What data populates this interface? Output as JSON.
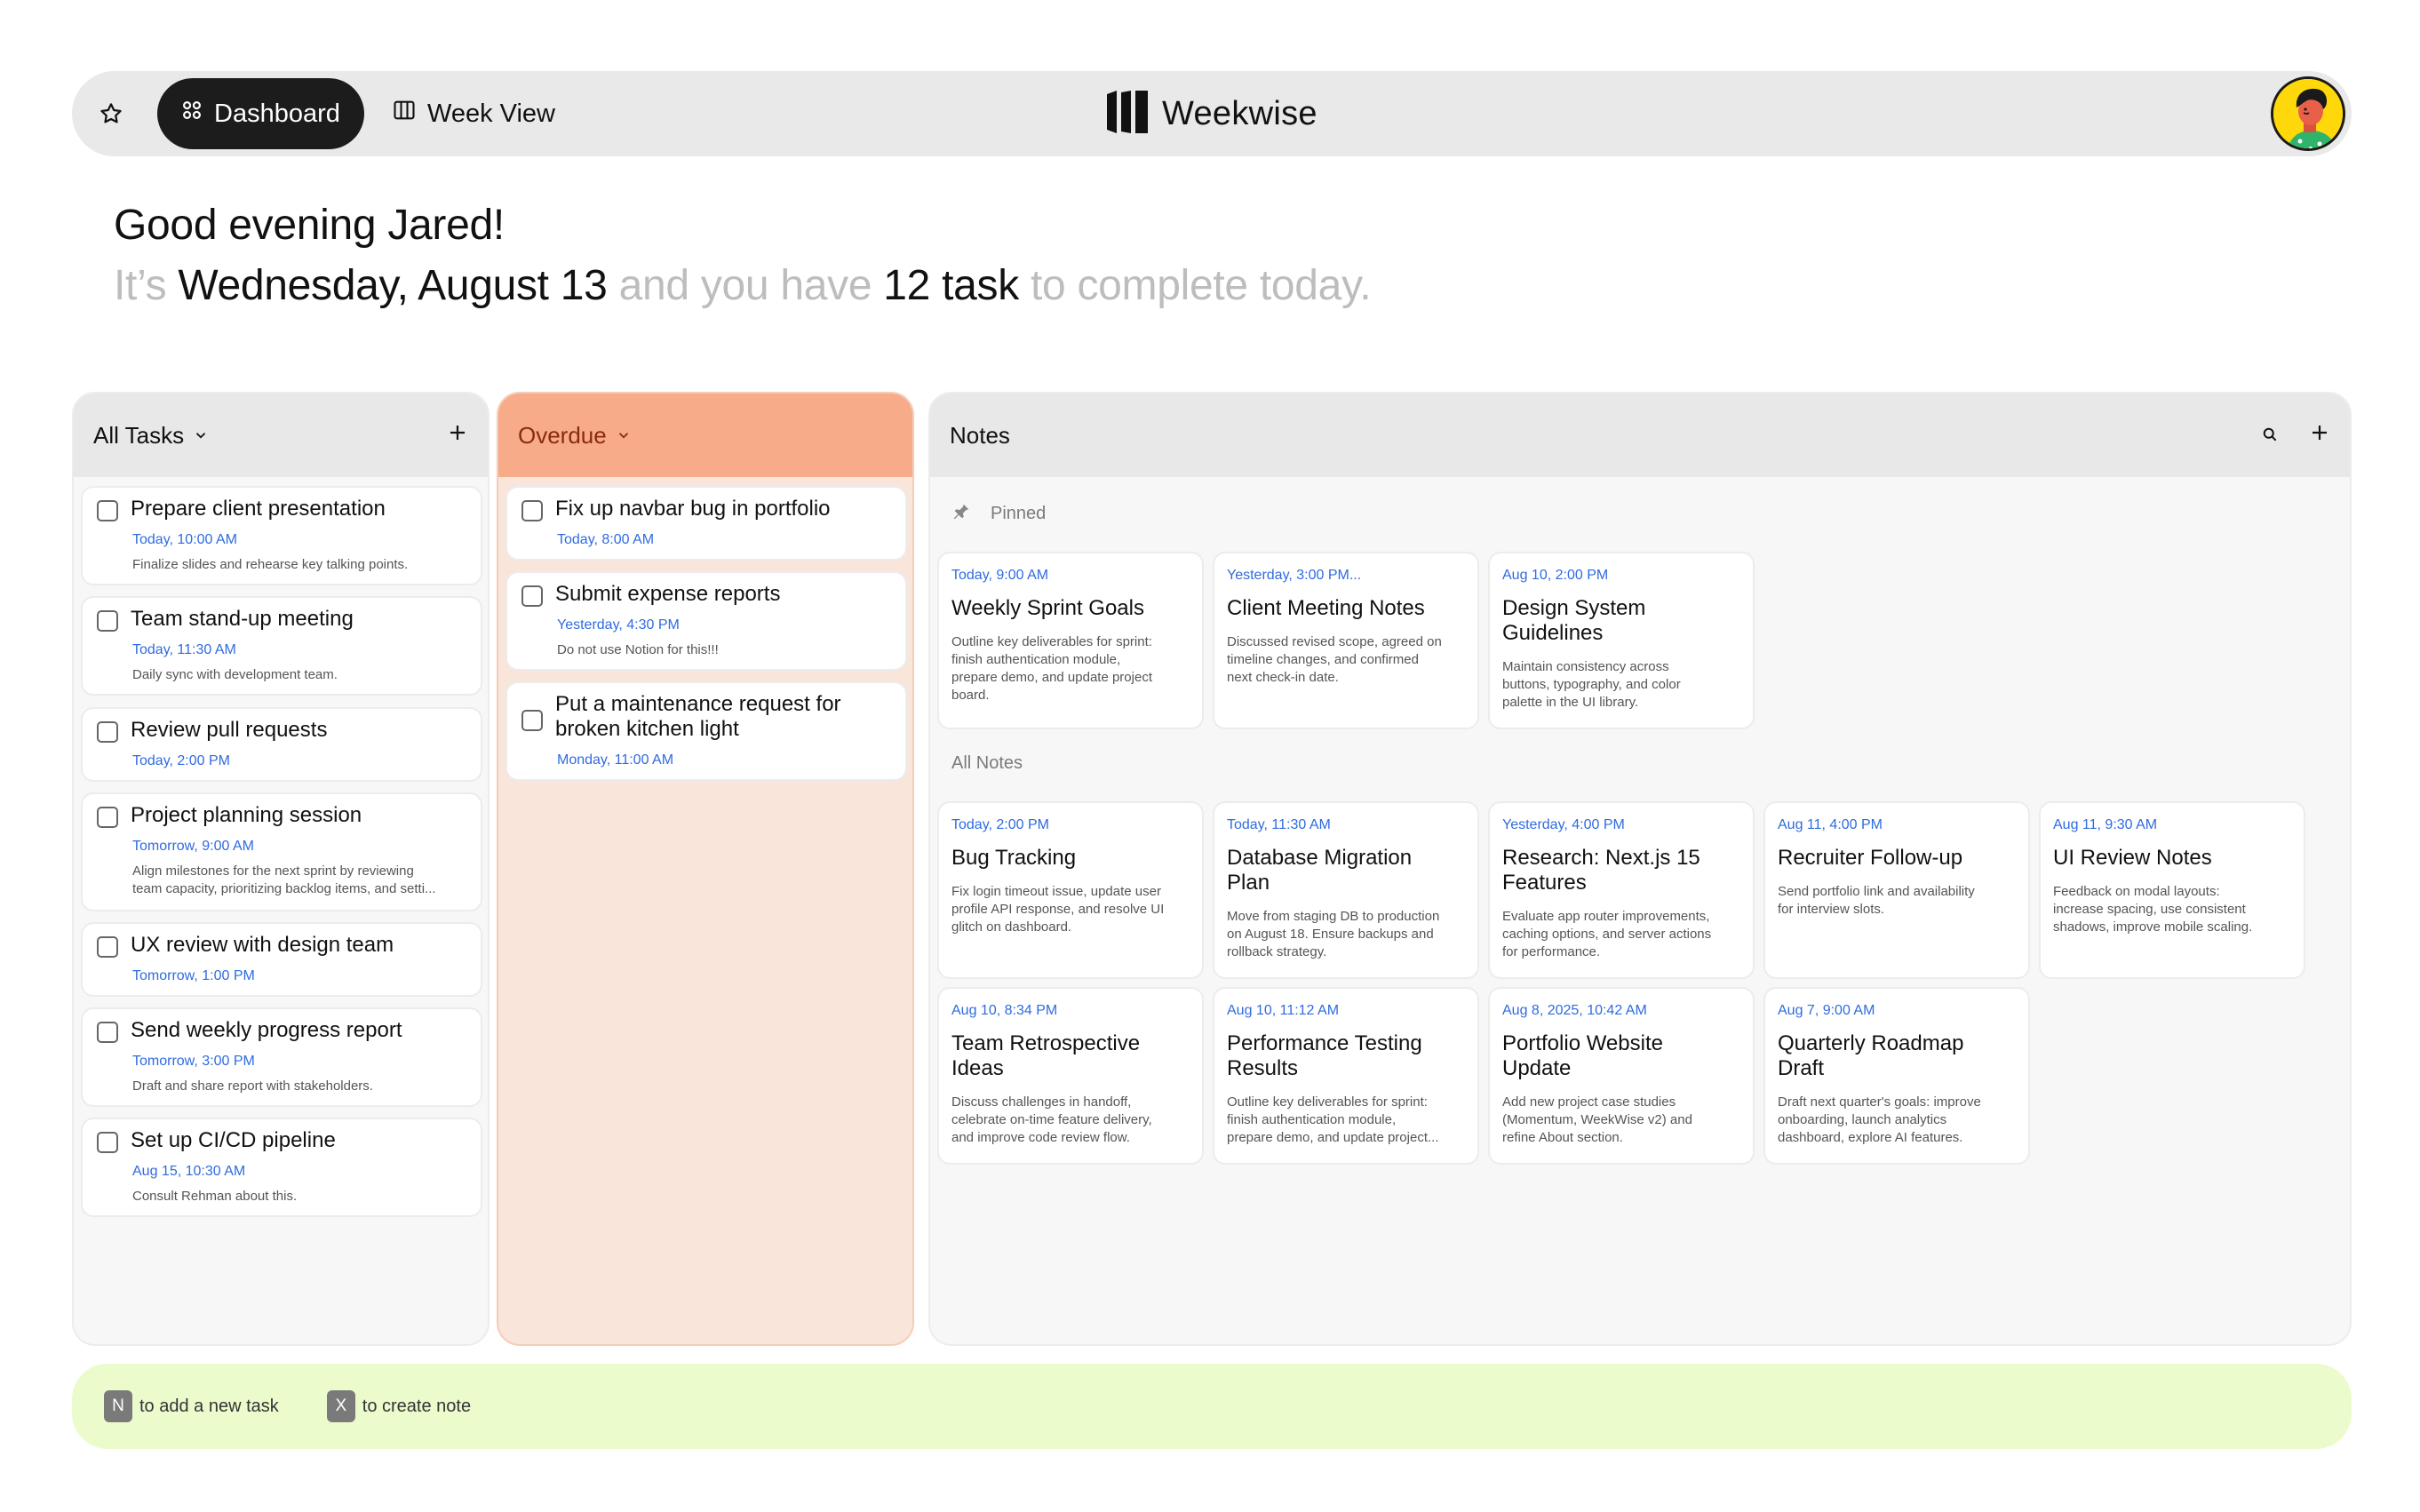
{
  "nav": {
    "tabs": [
      {
        "label": "Dashboard",
        "active": true,
        "icon": "grid-icon"
      },
      {
        "label": "Week View",
        "active": false,
        "icon": "columns-icon"
      }
    ],
    "brand": "Weekwise"
  },
  "greeting": {
    "line1": "Good evening Jared!",
    "p1": "It’s ",
    "date": "Wednesday, August 13",
    "p2": " and you have ",
    "count": "12 task",
    "p3": " to complete today."
  },
  "all_tasks": {
    "title": "All Tasks",
    "items": [
      {
        "title": "Prepare client presentation",
        "time": "Today, 10:00 AM",
        "desc": "Finalize slides and rehearse key talking points."
      },
      {
        "title": "Team stand-up meeting",
        "time": "Today, 11:30 AM",
        "desc": "Daily sync with development team."
      },
      {
        "title": "Review pull requests",
        "time": "Today, 2:00 PM",
        "desc": ""
      },
      {
        "title": "Project planning session",
        "time": "Tomorrow, 9:00 AM",
        "desc": "Align milestones for the next sprint by reviewing",
        "desc2": "team capacity, prioritizing backlog items, and setti..."
      },
      {
        "title": "UX review with design team",
        "time": "Tomorrow, 1:00 PM",
        "desc": ""
      },
      {
        "title": "Send weekly progress report",
        "time": "Tomorrow, 3:00 PM",
        "desc": "Draft and share report with stakeholders."
      },
      {
        "title": "Set up CI/CD pipeline",
        "time": "Aug 15, 10:30 AM",
        "desc": "Consult Rehman about this."
      }
    ]
  },
  "overdue": {
    "title": "Overdue",
    "items": [
      {
        "title": "Fix up navbar bug in portfolio",
        "time": "Today, 8:00 AM",
        "desc": ""
      },
      {
        "title": "Submit expense reports",
        "time": "Yesterday, 4:30 PM",
        "desc": "Do not use Notion for this!!!"
      },
      {
        "title": "Put a maintenance request for",
        "title2": "broken kitchen light",
        "time": "Monday, 11:00 AM",
        "desc": ""
      }
    ]
  },
  "notes": {
    "title": "Notes",
    "pinned_label": "Pinned",
    "all_label": "All Notes",
    "pinned": [
      {
        "time": "Today, 9:00 AM",
        "title": "Weekly Sprint Goals",
        "desc": [
          "Outline key deliverables for sprint:",
          "finish authentication module,",
          "prepare demo, and update project",
          "board."
        ]
      },
      {
        "time": "Yesterday, 3:00 PM...",
        "title": "Client Meeting Notes",
        "desc": [
          "Discussed revised scope, agreed on",
          "timeline changes, and confirmed",
          "next check-in date."
        ]
      },
      {
        "time": "Aug 10, 2:00 PM",
        "title": "Design System",
        "title2": "Guidelines",
        "desc": [
          "Maintain consistency across",
          "buttons, typography, and color",
          "palette in the UI library."
        ]
      }
    ],
    "all": [
      {
        "time": "Today, 2:00 PM",
        "title": "Bug Tracking",
        "desc": [
          "Fix login timeout issue, update user",
          "profile API response, and resolve UI",
          "glitch on dashboard."
        ]
      },
      {
        "time": "Today, 11:30 AM",
        "title": "Database Migration",
        "title2": "Plan",
        "desc": [
          "Move from staging DB to production",
          "on August 18. Ensure backups and",
          "rollback strategy."
        ]
      },
      {
        "time": "Yesterday, 4:00 PM",
        "title": "Research: Next.js 15",
        "title2": "Features",
        "desc": [
          "Evaluate app router improvements,",
          "caching options, and server actions",
          "for performance."
        ]
      },
      {
        "time": "Aug 11, 4:00 PM",
        "title": "Recruiter Follow-up",
        "desc": [
          "Send portfolio link and availability",
          "for interview slots."
        ]
      },
      {
        "time": "Aug 11, 9:30 AM",
        "title": "UI Review Notes",
        "desc": [
          "Feedback on modal layouts:",
          "increase spacing, use consistent",
          "shadows, improve mobile scaling."
        ]
      },
      {
        "time": "Aug 10, 8:34 PM",
        "title": "Team Retrospective",
        "title2": "Ideas",
        "desc": [
          "Discuss challenges in handoff,",
          "celebrate on-time feature delivery,",
          "and improve code review flow."
        ]
      },
      {
        "time": "Aug 10, 11:12 AM",
        "title": "Performance Testing",
        "title2": "Results",
        "desc": [
          "Outline key deliverables for sprint:",
          "finish authentication module,",
          "prepare demo, and update project..."
        ]
      },
      {
        "time": "Aug 8, 2025, 10:42 AM",
        "title": "Portfolio Website",
        "title2": "Update",
        "desc": [
          "Add new project case studies",
          "(Momentum, WeekWise v2) and",
          "refine About section."
        ]
      },
      {
        "time": "Aug 7, 9:00 AM",
        "title": "Quarterly Roadmap",
        "title2": "Draft",
        "desc": [
          "Draft next quarter's goals: improve",
          "onboarding, launch analytics",
          "dashboard, explore AI features."
        ]
      }
    ]
  },
  "footer": {
    "hints": [
      {
        "key": "N",
        "text": "to add a new task"
      },
      {
        "key": "X",
        "text": "to create note"
      }
    ]
  },
  "colors": {
    "accent_dark": "#1c1c1c",
    "overdue_head": "#f7ab88",
    "overdue_bg": "#f9e5da",
    "time_blue": "#2f6be0",
    "footer_bg": "#ecfbcc"
  }
}
